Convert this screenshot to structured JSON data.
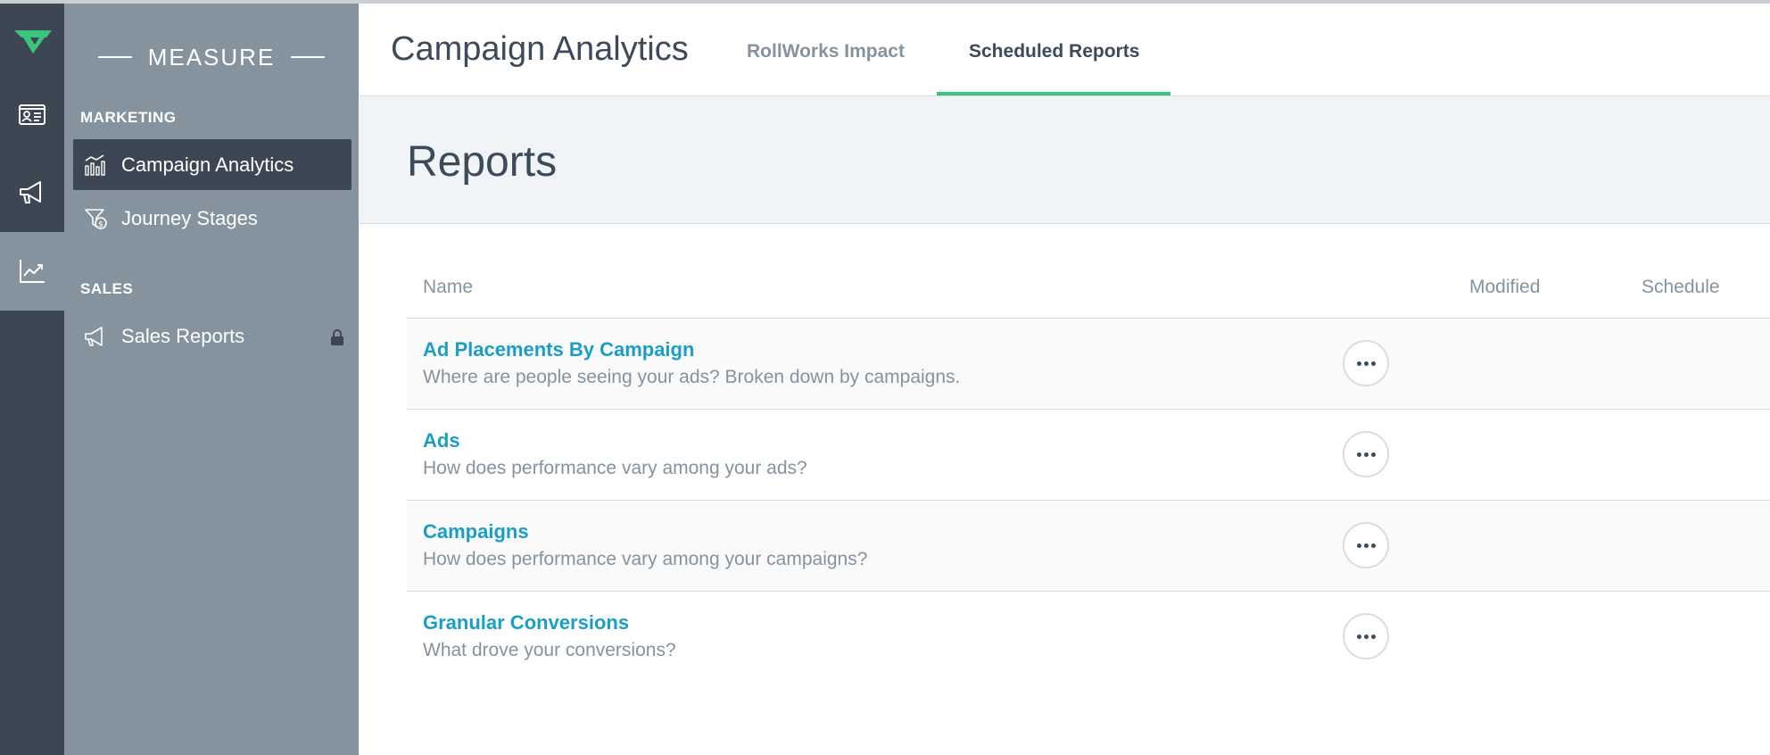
{
  "rail": {
    "icons": [
      "logo-icon",
      "contact-card-icon",
      "megaphone-icon",
      "trend-chart-icon"
    ]
  },
  "sidebar": {
    "brand": "MEASURE",
    "sections": [
      {
        "label": "MARKETING",
        "items": [
          {
            "label": "Campaign Analytics",
            "icon": "bar-chart-icon",
            "active": true
          },
          {
            "label": "Journey Stages",
            "icon": "funnel-dollar-icon",
            "active": false
          }
        ]
      },
      {
        "label": "SALES",
        "items": [
          {
            "label": "Sales Reports",
            "icon": "megaphone-icon",
            "locked": true
          }
        ]
      }
    ]
  },
  "header": {
    "title": "Campaign Analytics",
    "tabs": [
      {
        "label": "RollWorks Impact",
        "active": false
      },
      {
        "label": "Scheduled Reports",
        "active": true
      }
    ]
  },
  "page": {
    "heading": "Reports"
  },
  "table": {
    "columns": [
      "Name",
      "Modified",
      "Schedule"
    ],
    "rows": [
      {
        "name": "Ad Placements By Campaign",
        "description": "Where are people seeing your ads? Broken down by campaigns."
      },
      {
        "name": "Ads",
        "description": "How does performance vary among your ads?"
      },
      {
        "name": "Campaigns",
        "description": "How does performance vary among your campaigns?"
      },
      {
        "name": "Granular Conversions",
        "description": "What drove your conversions?"
      }
    ]
  },
  "colors": {
    "rail": "#3c4753",
    "sidebar": "#85939f",
    "accent": "#3cc47c",
    "link": "#1a9fc4"
  }
}
